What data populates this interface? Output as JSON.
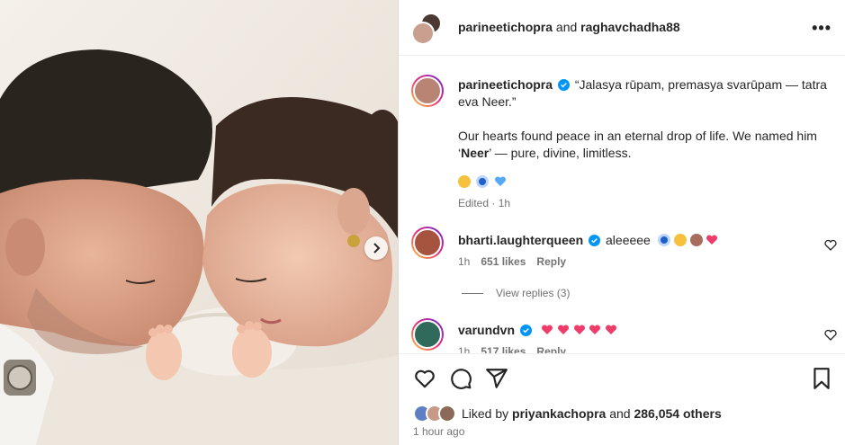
{
  "header": {
    "user1": "parineetichopra",
    "joiner": "and",
    "user2": "raghavchadha88",
    "more_label": "•••"
  },
  "caption": {
    "username": "parineetichopra",
    "quote": "“Jalasya rūpam, premasya svarūpam — tatra eva Neer.”",
    "line1": "Our hearts found peace in an eternal drop of life. We named him ‘",
    "bold_name": "Neer",
    "line2": "’ — pure, divine, limitless.",
    "meta": "Edited · 1h"
  },
  "comments": [
    {
      "username": "bharti.laughterqueen",
      "text": "aleeeee",
      "time": "1h",
      "likes": "651 likes",
      "reply": "Reply"
    },
    {
      "username": "varundvn",
      "text": "",
      "time": "1h",
      "likes": "517 likes",
      "reply": "Reply"
    }
  ],
  "view_replies": "View replies (3)",
  "likes": {
    "prefix": "Liked by",
    "user": "priyankachopra",
    "joiner": "and",
    "others": "286,054 others"
  },
  "time_ago": "1 hour ago",
  "colors": {
    "verified": "#0095f6",
    "heart_red": "#e2264d",
    "muted": "#737373"
  }
}
